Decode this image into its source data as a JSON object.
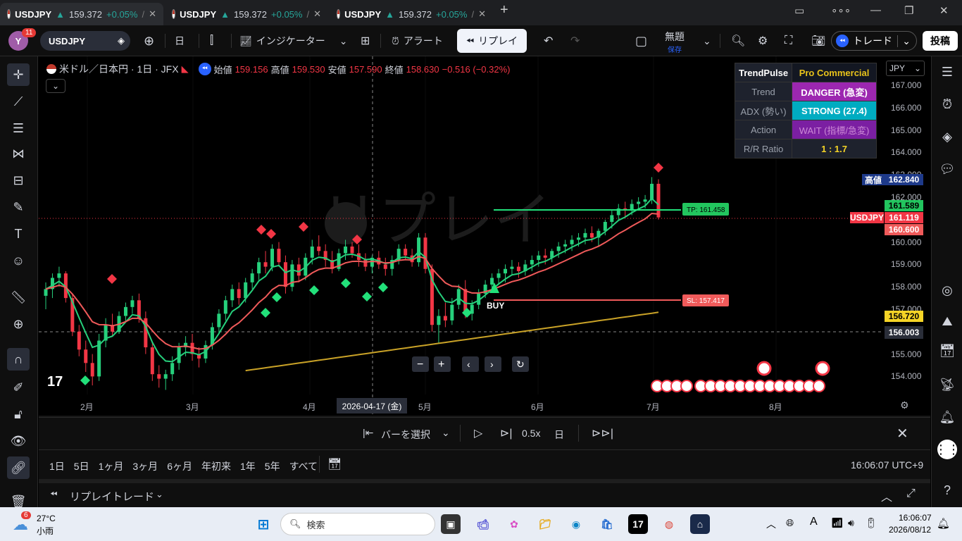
{
  "browser": {
    "tabs": [
      {
        "symbol": "USDJPY",
        "arrow": "▲",
        "price": "159.372",
        "change": "+0.05%",
        "sep": "/"
      },
      {
        "symbol": "USDJPY",
        "arrow": "▲",
        "price": "159.372",
        "change": "+0.05%",
        "sep": "/"
      },
      {
        "symbol": "USDJPY",
        "arrow": "▲",
        "price": "159.372",
        "change": "+0.05%",
        "sep": "/"
      }
    ],
    "new_tab": "+"
  },
  "toolbar": {
    "avatar": "Y",
    "notifications": "11",
    "symbol": "USDJPY",
    "interval": "日",
    "indicators": "インジケーター",
    "alert": "アラート",
    "replay": "リプレイ",
    "layout_name": "無題",
    "layout_status": "保存",
    "trade": "トレード",
    "post": "投稿"
  },
  "legend": {
    "title": "米ドル／日本円 · 1日 · JFX",
    "open_label": "始値",
    "open": "159.156",
    "high_label": "高値",
    "high": "159.530",
    "low_label": "安値",
    "low": "157.590",
    "close_label": "終値",
    "close": "158.630",
    "change": "−0.516 (−0.32%)"
  },
  "pro_table": {
    "header_left": "TrendPulse",
    "header_right": "Pro Commercial",
    "rows": [
      {
        "label": "Trend",
        "value": "DANGER (急変)"
      },
      {
        "label": "ADX (勢い)",
        "value": "STRONG (27.4)"
      },
      {
        "label": "Action",
        "value": "WAIT (指標/急変)"
      },
      {
        "label": "R/R Ratio",
        "value": "1 : 1.7"
      }
    ]
  },
  "price_axis": {
    "currency": "JPY",
    "labels": [
      "167.000",
      "166.000",
      "165.000",
      "164.000",
      "163.000",
      "162.000",
      "161.000",
      "160.000",
      "159.000",
      "158.000",
      "157.000",
      "156.000",
      "155.000",
      "154.000"
    ],
    "high_tag_label": "高値",
    "high_tag": "162.840",
    "tp_tag": "161.589",
    "current_symbol": "USDJPY",
    "current_tag": "161.119",
    "ma_tag": "160.600",
    "yellow_tag": "156.720",
    "crosshair_tag": "156.003"
  },
  "time_axis": {
    "labels": [
      "2月",
      "3月",
      "4月",
      "5月",
      "6月",
      "7月",
      "8月"
    ],
    "crosshair_date": "2026-04-17 (金)"
  },
  "chart_annotations": {
    "tp_label": "TP: 161.458",
    "sl_label": "SL: 157.417",
    "buy_label": "BUY",
    "watermark": "リプレイ"
  },
  "chart_data": {
    "type": "candlestick",
    "symbol": "USDJPY",
    "interval": "1D",
    "ylim": [
      153.5,
      167.5
    ],
    "tp": 161.458,
    "sl": 157.417,
    "current": 161.119,
    "candles": [
      [
        157.6,
        158.2,
        157.0,
        157.9
      ],
      [
        157.9,
        158.6,
        157.5,
        158.4
      ],
      [
        158.4,
        158.9,
        158.0,
        158.6
      ],
      [
        158.6,
        158.7,
        157.3,
        157.5
      ],
      [
        157.5,
        157.7,
        155.8,
        156.0
      ],
      [
        156.0,
        156.3,
        154.9,
        155.2
      ],
      [
        155.2,
        155.6,
        154.2,
        154.6
      ],
      [
        154.6,
        155.0,
        153.6,
        154.0
      ],
      [
        154.0,
        155.9,
        153.8,
        155.6
      ],
      [
        155.6,
        156.6,
        155.3,
        156.3
      ],
      [
        156.3,
        156.8,
        155.8,
        156.0
      ],
      [
        156.0,
        156.9,
        155.9,
        156.7
      ],
      [
        156.7,
        157.3,
        156.4,
        157.1
      ],
      [
        157.1,
        157.6,
        156.8,
        157.4
      ],
      [
        157.4,
        157.7,
        156.4,
        156.6
      ],
      [
        156.6,
        156.9,
        155.0,
        155.3
      ],
      [
        155.3,
        155.5,
        153.8,
        154.1
      ],
      [
        154.1,
        154.5,
        153.5,
        153.9
      ],
      [
        153.9,
        154.3,
        153.4,
        154.1
      ],
      [
        154.1,
        154.9,
        153.8,
        154.6
      ],
      [
        154.6,
        155.5,
        154.3,
        155.3
      ],
      [
        155.3,
        155.8,
        154.9,
        155.5
      ],
      [
        155.5,
        155.9,
        154.7,
        155.0
      ],
      [
        155.0,
        155.3,
        154.4,
        154.8
      ],
      [
        154.8,
        155.6,
        154.6,
        155.4
      ],
      [
        155.4,
        156.4,
        155.2,
        156.2
      ],
      [
        156.2,
        157.0,
        155.9,
        156.8
      ],
      [
        156.8,
        157.6,
        156.5,
        157.4
      ],
      [
        157.4,
        158.1,
        157.1,
        157.9
      ],
      [
        157.9,
        158.2,
        157.2,
        157.5
      ],
      [
        157.5,
        158.4,
        157.3,
        158.2
      ],
      [
        158.2,
        158.8,
        157.9,
        158.6
      ],
      [
        158.6,
        159.3,
        158.3,
        159.1
      ],
      [
        159.1,
        159.6,
        158.6,
        158.9
      ],
      [
        158.9,
        159.9,
        158.7,
        159.7
      ],
      [
        159.7,
        160.0,
        158.9,
        159.1
      ],
      [
        159.1,
        159.4,
        157.7,
        158.0
      ],
      [
        158.0,
        159.2,
        157.8,
        159.0
      ],
      [
        159.0,
        159.3,
        158.2,
        158.5
      ],
      [
        158.5,
        159.5,
        158.3,
        159.3
      ],
      [
        159.3,
        160.1,
        159.0,
        159.8
      ],
      [
        159.8,
        160.3,
        159.4,
        159.6
      ],
      [
        159.6,
        159.9,
        158.9,
        159.2
      ],
      [
        159.2,
        159.6,
        158.6,
        158.8
      ],
      [
        158.8,
        159.7,
        158.7,
        159.5
      ],
      [
        159.5,
        160.1,
        159.2,
        159.8
      ],
      [
        159.8,
        160.0,
        159.3,
        159.5
      ],
      [
        159.5,
        159.9,
        158.9,
        159.2
      ],
      [
        159.2,
        159.5,
        158.7,
        158.9
      ],
      [
        158.9,
        159.4,
        158.6,
        159.3
      ],
      [
        159.3,
        159.6,
        158.8,
        159.0
      ],
      [
        159.0,
        159.3,
        158.5,
        158.8
      ],
      [
        158.8,
        159.4,
        158.5,
        159.2
      ],
      [
        159.2,
        159.9,
        159.0,
        159.7
      ],
      [
        159.7,
        159.9,
        159.2,
        159.4
      ],
      [
        159.4,
        159.7,
        158.9,
        159.1
      ],
      [
        159.1,
        160.4,
        158.9,
        160.2
      ],
      [
        160.2,
        160.4,
        158.6,
        158.8
      ],
      [
        158.8,
        159.0,
        156.0,
        156.3
      ],
      [
        156.3,
        157.0,
        155.5,
        156.7
      ],
      [
        156.7,
        157.3,
        156.2,
        156.5
      ],
      [
        156.5,
        157.5,
        156.3,
        157.2
      ],
      [
        157.2,
        158.1,
        157.0,
        157.9
      ],
      [
        157.9,
        158.3,
        156.6,
        156.8
      ],
      [
        156.8,
        157.4,
        156.5,
        157.2
      ],
      [
        157.2,
        157.9,
        157.0,
        157.7
      ],
      [
        157.7,
        158.3,
        157.5,
        158.1
      ],
      [
        158.1,
        158.6,
        157.8,
        158.4
      ],
      [
        158.4,
        158.8,
        158.1,
        158.6
      ],
      [
        158.6,
        159.0,
        158.2,
        158.8
      ],
      [
        158.8,
        159.2,
        158.5,
        158.9
      ],
      [
        158.9,
        159.1,
        158.4,
        158.7
      ],
      [
        158.7,
        159.2,
        158.5,
        159.0
      ],
      [
        159.0,
        159.4,
        158.7,
        159.2
      ],
      [
        159.2,
        159.6,
        158.9,
        159.4
      ],
      [
        159.4,
        159.7,
        159.0,
        159.3
      ],
      [
        159.3,
        159.7,
        159.1,
        159.6
      ],
      [
        159.6,
        160.0,
        159.3,
        159.8
      ],
      [
        159.8,
        160.1,
        159.5,
        159.9
      ],
      [
        159.9,
        160.3,
        159.6,
        160.1
      ],
      [
        160.1,
        160.4,
        159.8,
        160.2
      ],
      [
        160.2,
        160.6,
        159.9,
        160.4
      ],
      [
        160.4,
        160.7,
        160.0,
        160.2
      ],
      [
        160.2,
        160.6,
        159.8,
        160.5
      ],
      [
        160.5,
        161.0,
        160.3,
        160.9
      ],
      [
        160.9,
        161.4,
        160.6,
        161.2
      ],
      [
        161.2,
        161.7,
        161.0,
        161.5
      ],
      [
        161.5,
        161.8,
        161.1,
        161.4
      ],
      [
        161.4,
        161.9,
        161.2,
        161.7
      ],
      [
        161.7,
        162.0,
        161.4,
        161.8
      ],
      [
        161.8,
        162.1,
        161.5,
        161.9
      ],
      [
        161.9,
        162.9,
        161.7,
        162.6
      ],
      [
        162.6,
        162.8,
        161.0,
        161.1
      ]
    ]
  },
  "replay_bar": {
    "select_bar": "バーを選択",
    "speed": "0.5x",
    "interval": "日"
  },
  "range_bar": {
    "ranges": [
      "1日",
      "5日",
      "1ヶ月",
      "3ヶ月",
      "6ヶ月",
      "年初来",
      "1年",
      "5年",
      "すべて"
    ],
    "clock": "16:06:07 UTC+9"
  },
  "trade_bar": {
    "title": "リプレイトレード"
  },
  "taskbar": {
    "weather_temp": "27°C",
    "weather_desc": "小雨",
    "weather_badge": "6",
    "search": "検索",
    "time": "16:06:07",
    "date": "2026/08/12",
    "lang": "A"
  }
}
